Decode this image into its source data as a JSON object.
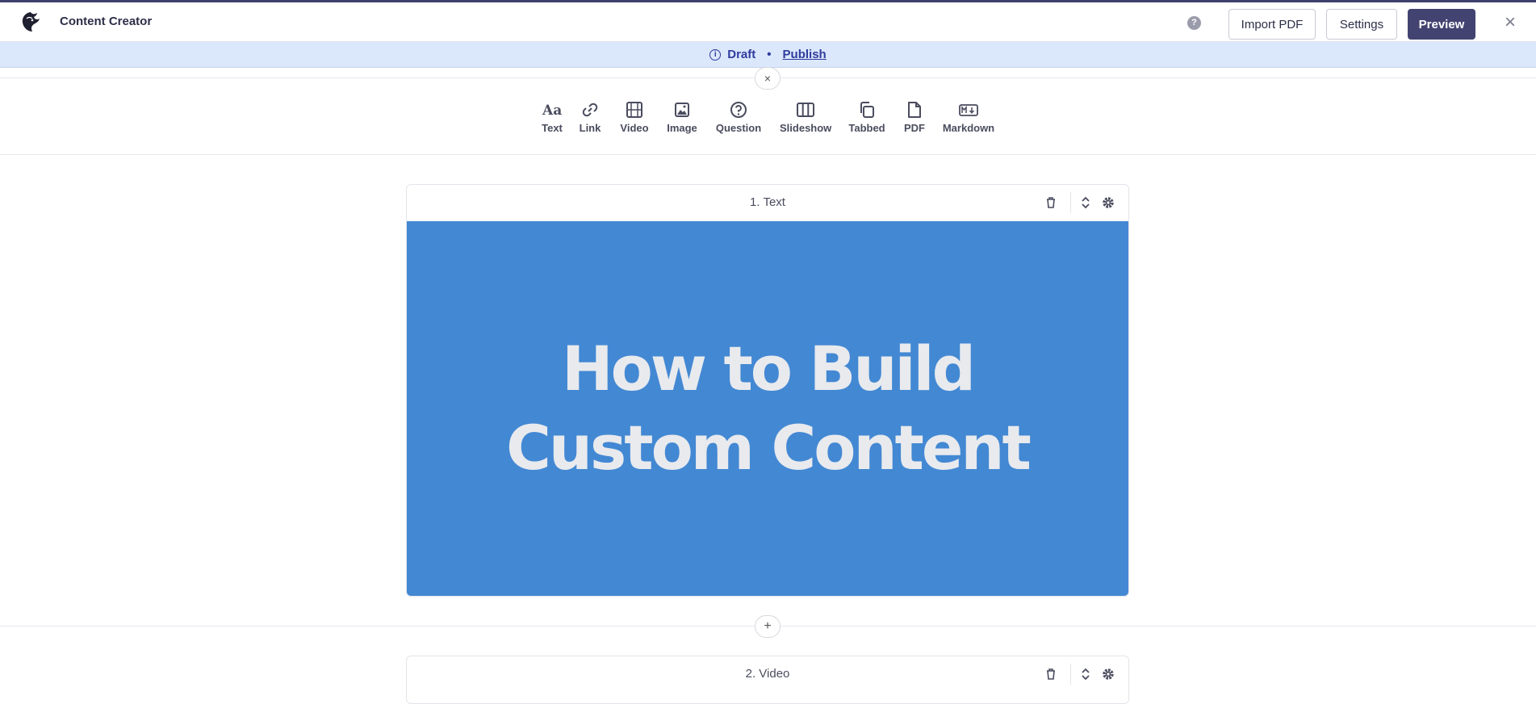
{
  "app": {
    "title": "Content Creator",
    "logo_icon": "eagle-logo"
  },
  "header": {
    "help_label": "?",
    "import_pdf_label": "Import PDF",
    "settings_label": "Settings",
    "preview_label": "Preview",
    "close_icon": "close-icon"
  },
  "status": {
    "state": "Draft",
    "separator": "•",
    "publish_label": "Publish"
  },
  "toolbar": {
    "collapse_label": "×",
    "tools": [
      {
        "label": "Text",
        "icon": "text-icon"
      },
      {
        "label": "Link",
        "icon": "link-icon"
      },
      {
        "label": "Video",
        "icon": "film-icon"
      },
      {
        "label": "Image",
        "icon": "image-icon"
      },
      {
        "label": "Question",
        "icon": "question-icon"
      },
      {
        "label": "Slideshow",
        "icon": "columns-icon"
      },
      {
        "label": "Tabbed",
        "icon": "copy-icon"
      },
      {
        "label": "PDF",
        "icon": "file-icon"
      },
      {
        "label": "Markdown",
        "icon": "markdown-icon"
      }
    ]
  },
  "blocks": [
    {
      "title": "1. Text",
      "hero_line1": "How to Build",
      "hero_line2": "Custom Content",
      "hero_color": "#4388d3"
    },
    {
      "title": "2. Video"
    }
  ],
  "add_block_label": "+",
  "colors": {
    "accent": "#434372",
    "status_bg": "#dbe7fb",
    "status_text": "#2f3c9e"
  }
}
